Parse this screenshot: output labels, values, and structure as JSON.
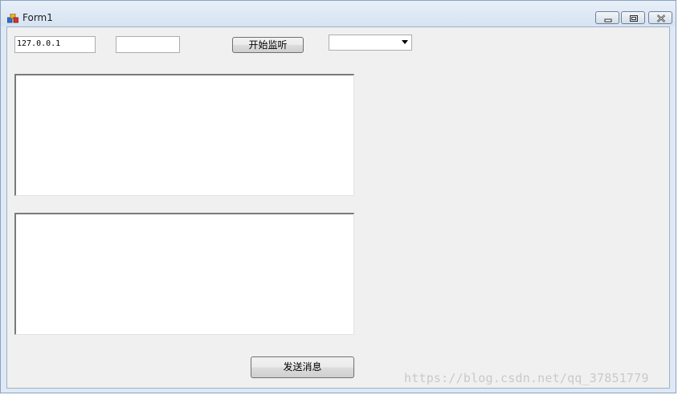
{
  "window": {
    "title": "Form1",
    "controls": {
      "minimize": "minimize",
      "maximize": "maximize",
      "close": "close"
    }
  },
  "form": {
    "ip_input": {
      "value": "127.0.0.1"
    },
    "port_input": {
      "value": ""
    },
    "listen_button": {
      "label": "开始监听"
    },
    "client_combo": {
      "selected": ""
    },
    "send_button": {
      "label": "发送消息"
    }
  },
  "watermark": "https://blog.csdn.net/qq_37851779",
  "colors": {
    "client_bg": "#f0f0f0",
    "titlebar": "#dfe9f5",
    "text": "#000000"
  }
}
